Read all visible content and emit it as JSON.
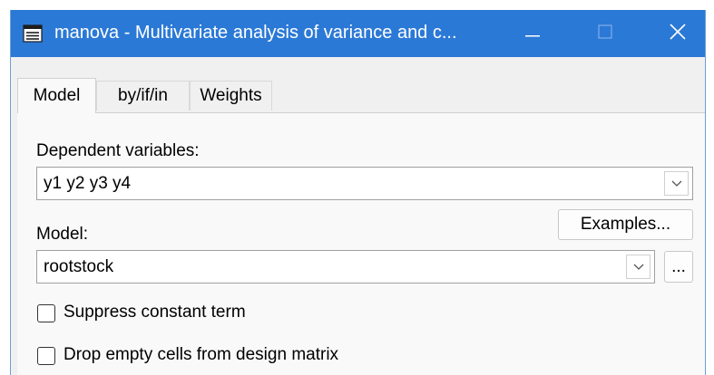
{
  "window": {
    "title": "manova - Multivariate analysis of variance and c...",
    "icon": "dialog-list-icon"
  },
  "titlebar_buttons": {
    "minimize": "minimize-icon",
    "maximize": "maximize-icon",
    "close": "close-icon"
  },
  "tabs": [
    {
      "label": "Model",
      "active": true
    },
    {
      "label": "by/if/in",
      "active": false
    },
    {
      "label": "Weights",
      "active": false
    }
  ],
  "form": {
    "dependent_label": "Dependent variables:",
    "dependent_value": "y1 y2 y3 y4",
    "model_label": "Model:",
    "model_value": "rootstock",
    "examples_button": "Examples...",
    "browse_button": "...",
    "suppress_constant": {
      "label": "Suppress constant term",
      "checked": false
    },
    "drop_empty": {
      "label": "Drop empty cells from design matrix",
      "checked": false
    }
  },
  "colors": {
    "titlebar": "#2b79d6",
    "dialog_bg": "#f0f0f0"
  }
}
